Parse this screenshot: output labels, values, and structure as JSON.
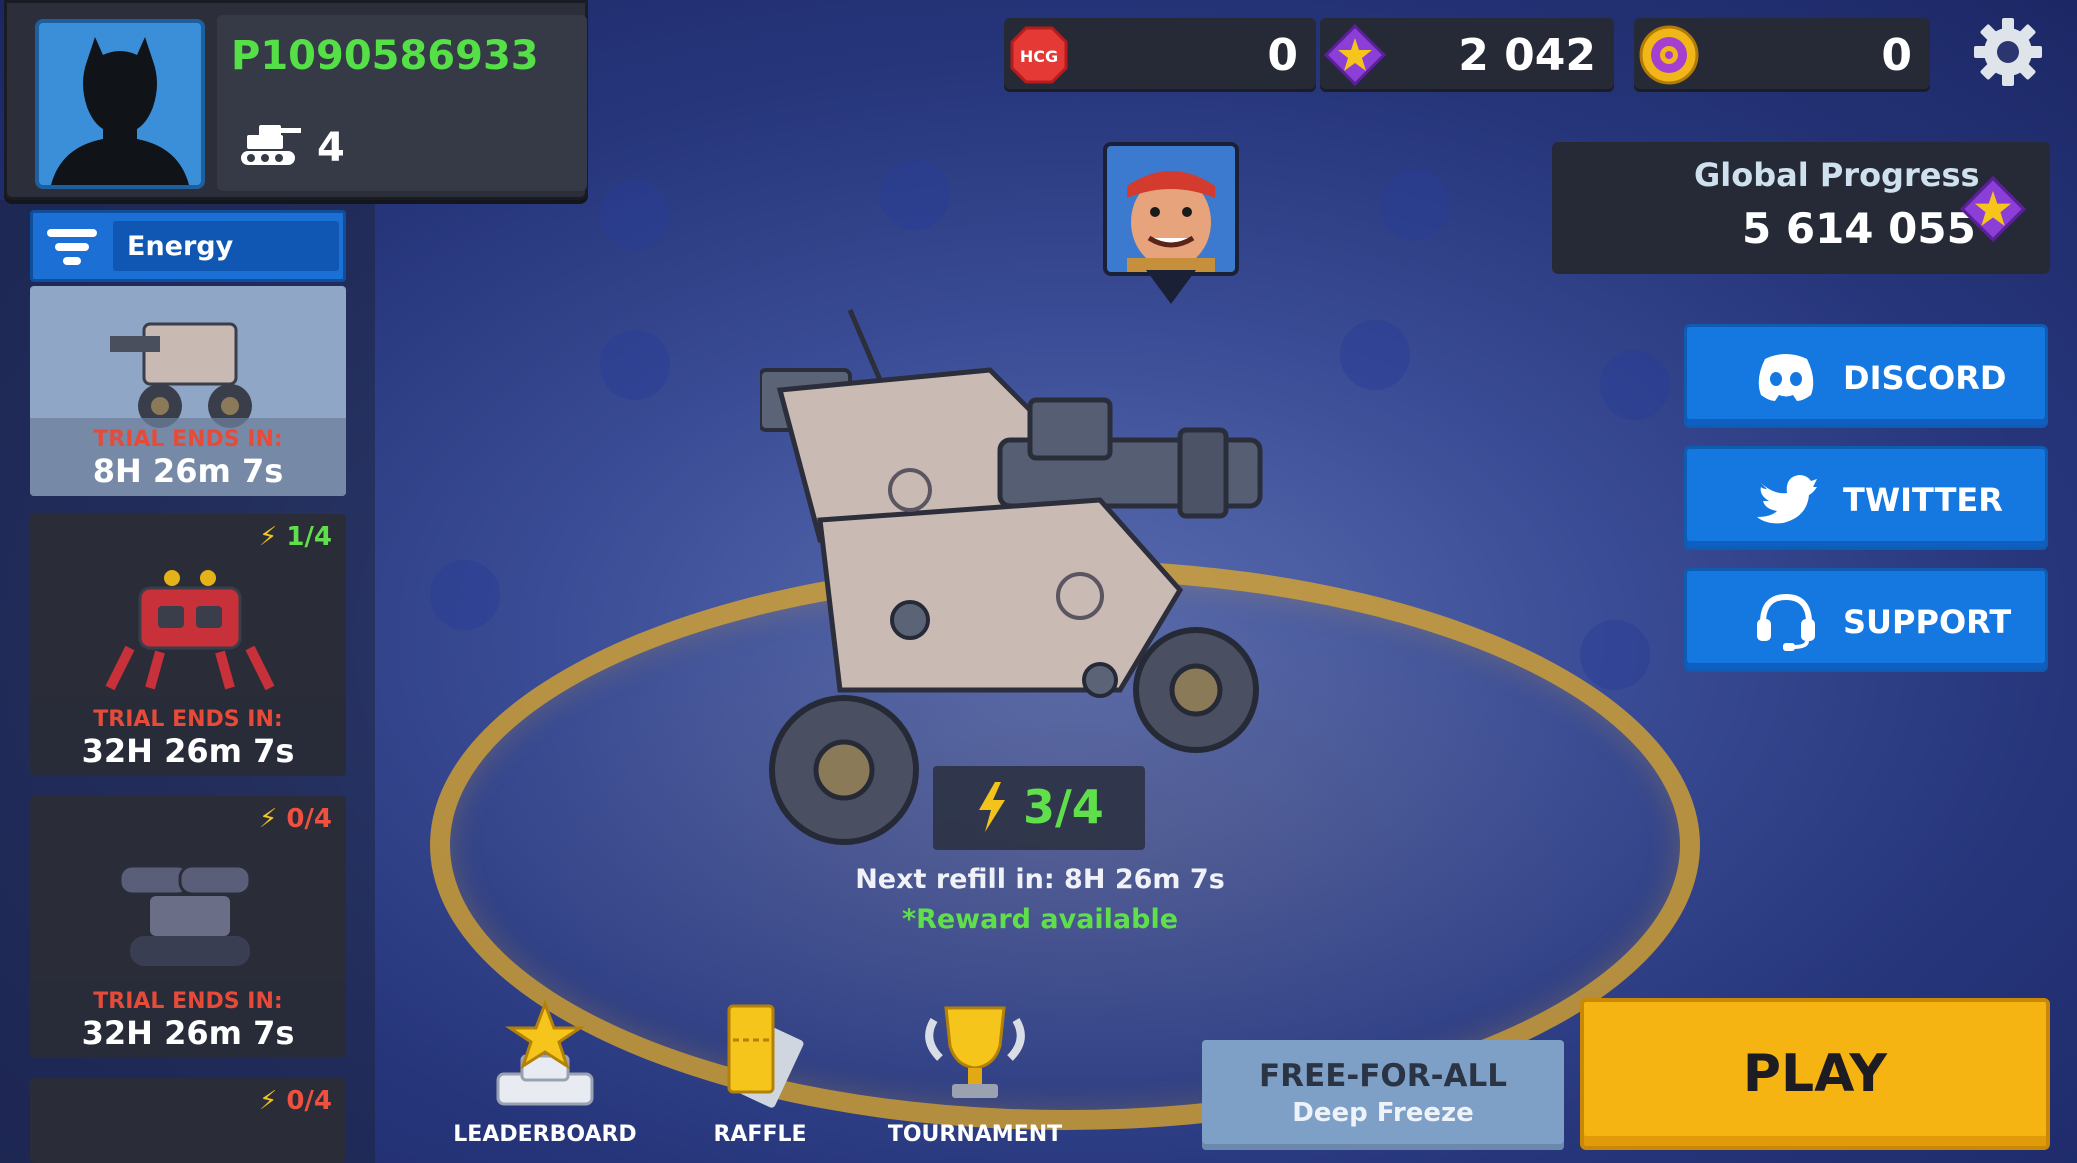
{
  "player": {
    "id": "P1090586933",
    "tank_count": "4"
  },
  "currencies": [
    {
      "name": "hcg",
      "icon": "hcg-token-icon",
      "value": "0"
    },
    {
      "name": "stars",
      "icon": "purple-star-gem-icon",
      "value": "2 042"
    },
    {
      "name": "gears",
      "icon": "gold-gear-coin-icon",
      "value": "0"
    }
  ],
  "global_progress": {
    "label": "Global Progress",
    "value": "5 614 055"
  },
  "social": {
    "discord": "DISCORD",
    "twitter": "TWITTER",
    "support": "SUPPORT"
  },
  "filter": {
    "label": "Energy"
  },
  "tanks": [
    {
      "energy": "",
      "trial_label": "TRIAL ENDS IN:",
      "trial_time": "8H 26m 7s"
    },
    {
      "energy": "1/4",
      "trial_label": "TRIAL ENDS IN:",
      "trial_time": "32H 26m 7s"
    },
    {
      "energy": "0/4",
      "trial_label": "TRIAL ENDS IN:",
      "trial_time": "32H 26m 7s"
    },
    {
      "energy": "0/4",
      "trial_label": "",
      "trial_time": ""
    }
  ],
  "energy": {
    "value": "3/4",
    "refill": "Next refill in: 8H 26m 7s",
    "reward": "*Reward available"
  },
  "nav": {
    "leaderboard": "LEADERBOARD",
    "raffle": "RAFFLE",
    "tournament": "TOURNAMENT"
  },
  "mode": {
    "title": "FREE-FOR-ALL",
    "subtitle": "Deep Freeze"
  },
  "play": {
    "label": "PLAY"
  },
  "colors": {
    "accent_blue": "#1577e0",
    "play_yellow": "#f6b413",
    "energy_green": "#5fe04b",
    "trial_red": "#e64b3a"
  }
}
